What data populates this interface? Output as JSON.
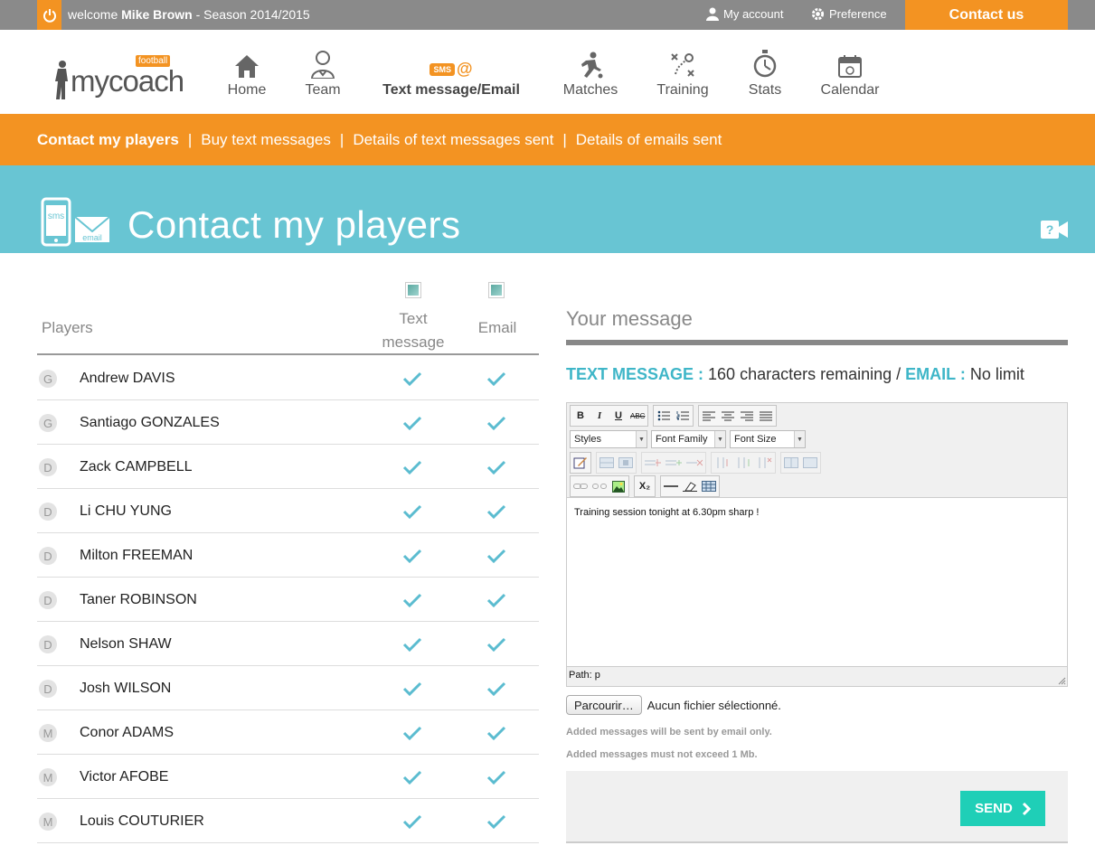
{
  "topbar": {
    "welcome_prefix": "welcome",
    "user_name": "Mike Brown",
    "season": "- Season 2014/2015",
    "my_account": "My account",
    "preference": "Preference",
    "contact_us": "Contact us"
  },
  "logo": {
    "text": "mycoach",
    "badge": "football"
  },
  "nav": [
    {
      "label": "Home",
      "icon": "house-icon"
    },
    {
      "label": "Team",
      "icon": "player-icon"
    },
    {
      "label": "Text message/Email",
      "icon": "sms-at-icon",
      "badge_sms": "SMS",
      "badge_at": "@"
    },
    {
      "label": "Matches",
      "icon": "kicker-icon"
    },
    {
      "label": "Training",
      "icon": "tactics-icon"
    },
    {
      "label": "Stats",
      "icon": "stopwatch-icon"
    },
    {
      "label": "Calendar",
      "icon": "calendar-icon"
    }
  ],
  "subnav": [
    "Contact my players",
    "Buy text messages",
    "Details of text messages sent",
    "Details of emails sent"
  ],
  "banner": {
    "title": "Contact my players",
    "icon_sms": "sms",
    "icon_email": "email",
    "help_mark": "?"
  },
  "players_table": {
    "col_players": "Players",
    "col_text": "Text message",
    "col_email": "Email",
    "rows": [
      {
        "pos": "G",
        "name": "Andrew DAVIS"
      },
      {
        "pos": "G",
        "name": "Santiago GONZALES"
      },
      {
        "pos": "D",
        "name": "Zack CAMPBELL"
      },
      {
        "pos": "D",
        "name": "Li CHU YUNG"
      },
      {
        "pos": "D",
        "name": "Milton FREEMAN"
      },
      {
        "pos": "D",
        "name": "Taner ROBINSON"
      },
      {
        "pos": "D",
        "name": "Nelson SHAW"
      },
      {
        "pos": "D",
        "name": "Josh WILSON"
      },
      {
        "pos": "M",
        "name": "Conor ADAMS"
      },
      {
        "pos": "M",
        "name": "Victor AFOBE"
      },
      {
        "pos": "M",
        "name": "Louis COUTURIER"
      }
    ]
  },
  "message": {
    "title": "Your message",
    "text_label": "TEXT MESSAGE :",
    "text_remaining": "160 characters remaining /",
    "email_label": "EMAIL :",
    "email_limit": "No limit",
    "toolbar": {
      "bold": "B",
      "italic": "I",
      "underline": "U",
      "strike": "ABC",
      "styles": "Styles",
      "font_family": "Font Family",
      "font_size": "Font Size",
      "subscript": "X₂"
    },
    "body": "Training session tonight at 6.30pm sharp !",
    "path": "Path: p",
    "browse_button": "Parcourir…",
    "no_file": "Aucun fichier sélectionné.",
    "note_1": "Added messages will be sent by email only.",
    "note_2": "Added messages must not exceed 1 Mb.",
    "send": "SEND"
  },
  "colors": {
    "orange": "#f39322",
    "teal": "#68c5d3",
    "check": "#5bbcd0",
    "send": "#1fcfb7",
    "topbar": "#8a8a8a"
  }
}
